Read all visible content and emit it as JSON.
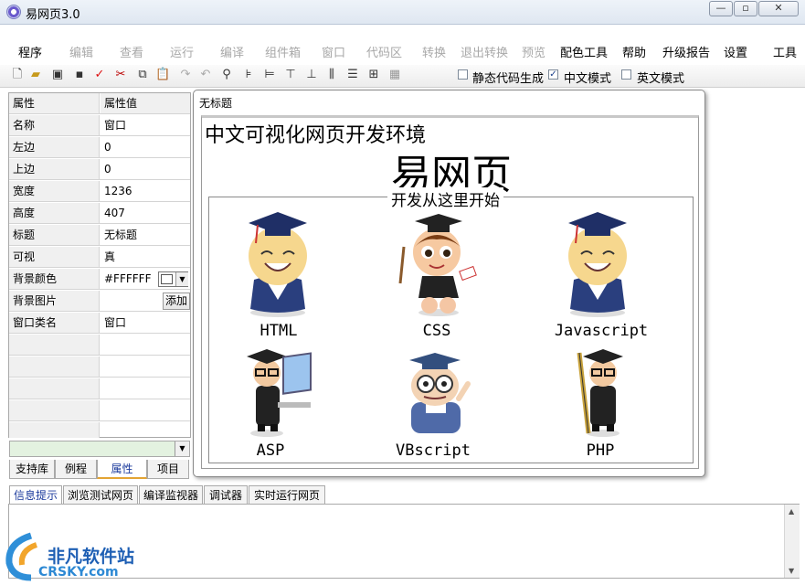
{
  "window": {
    "title": "易网页3.0"
  },
  "menu": [
    {
      "label": "程序",
      "enabled": true
    },
    {
      "label": "编辑",
      "enabled": false
    },
    {
      "label": "查看",
      "enabled": false
    },
    {
      "label": "运行",
      "enabled": false
    },
    {
      "label": "编译",
      "enabled": false
    },
    {
      "label": "组件箱",
      "enabled": false
    },
    {
      "label": "窗口",
      "enabled": false
    },
    {
      "label": "代码区",
      "enabled": false
    },
    {
      "label": "转换",
      "enabled": false
    },
    {
      "label": "退出转换",
      "enabled": false
    },
    {
      "label": "预览",
      "enabled": false
    },
    {
      "label": "配色工具",
      "enabled": true
    },
    {
      "label": "帮助",
      "enabled": true
    },
    {
      "label": "升级报告",
      "enabled": true
    },
    {
      "label": "设置",
      "enabled": true
    },
    {
      "label": "工具",
      "enabled": true
    }
  ],
  "toolbar": {
    "options": [
      {
        "label": "静态代码生成",
        "checked": false
      },
      {
        "label": "中文模式",
        "checked": true
      },
      {
        "label": "英文模式",
        "checked": false
      }
    ]
  },
  "properties": {
    "header": {
      "key": "属性",
      "value": "属性值"
    },
    "rows": [
      {
        "key": "名称",
        "value": "窗口"
      },
      {
        "key": "左边",
        "value": "0"
      },
      {
        "key": "上边",
        "value": "0"
      },
      {
        "key": "宽度",
        "value": "1236"
      },
      {
        "key": "高度",
        "value": "407"
      },
      {
        "key": "标题",
        "value": "无标题"
      },
      {
        "key": "可视",
        "value": "真"
      },
      {
        "key": "背景颜色",
        "value": "#FFFFFF"
      },
      {
        "key": "背景图片",
        "value": ""
      },
      {
        "key": "窗口类名",
        "value": "窗口"
      }
    ],
    "add_button": "添加",
    "bg_color_swatch": "#FFFFFF"
  },
  "left_tabs": [
    "支持库",
    "例程",
    "属性",
    "项目"
  ],
  "left_tabs_active": "属性",
  "design": {
    "window_title": "无标题",
    "heading": "中文可视化网页开发环境",
    "brand": "易网页",
    "group_title": "开发从这里开始",
    "items": [
      "HTML",
      "CSS",
      "Javascript",
      "ASP",
      "VBscript",
      "PHP"
    ]
  },
  "bottom_tabs": [
    "信息提示",
    "浏览测试网页",
    "编译监视器",
    "调试器",
    "实时运行网页"
  ],
  "bottom_tabs_active": "信息提示",
  "watermark": {
    "line1": "非凡软件站",
    "line2": "CRSKY.com"
  }
}
